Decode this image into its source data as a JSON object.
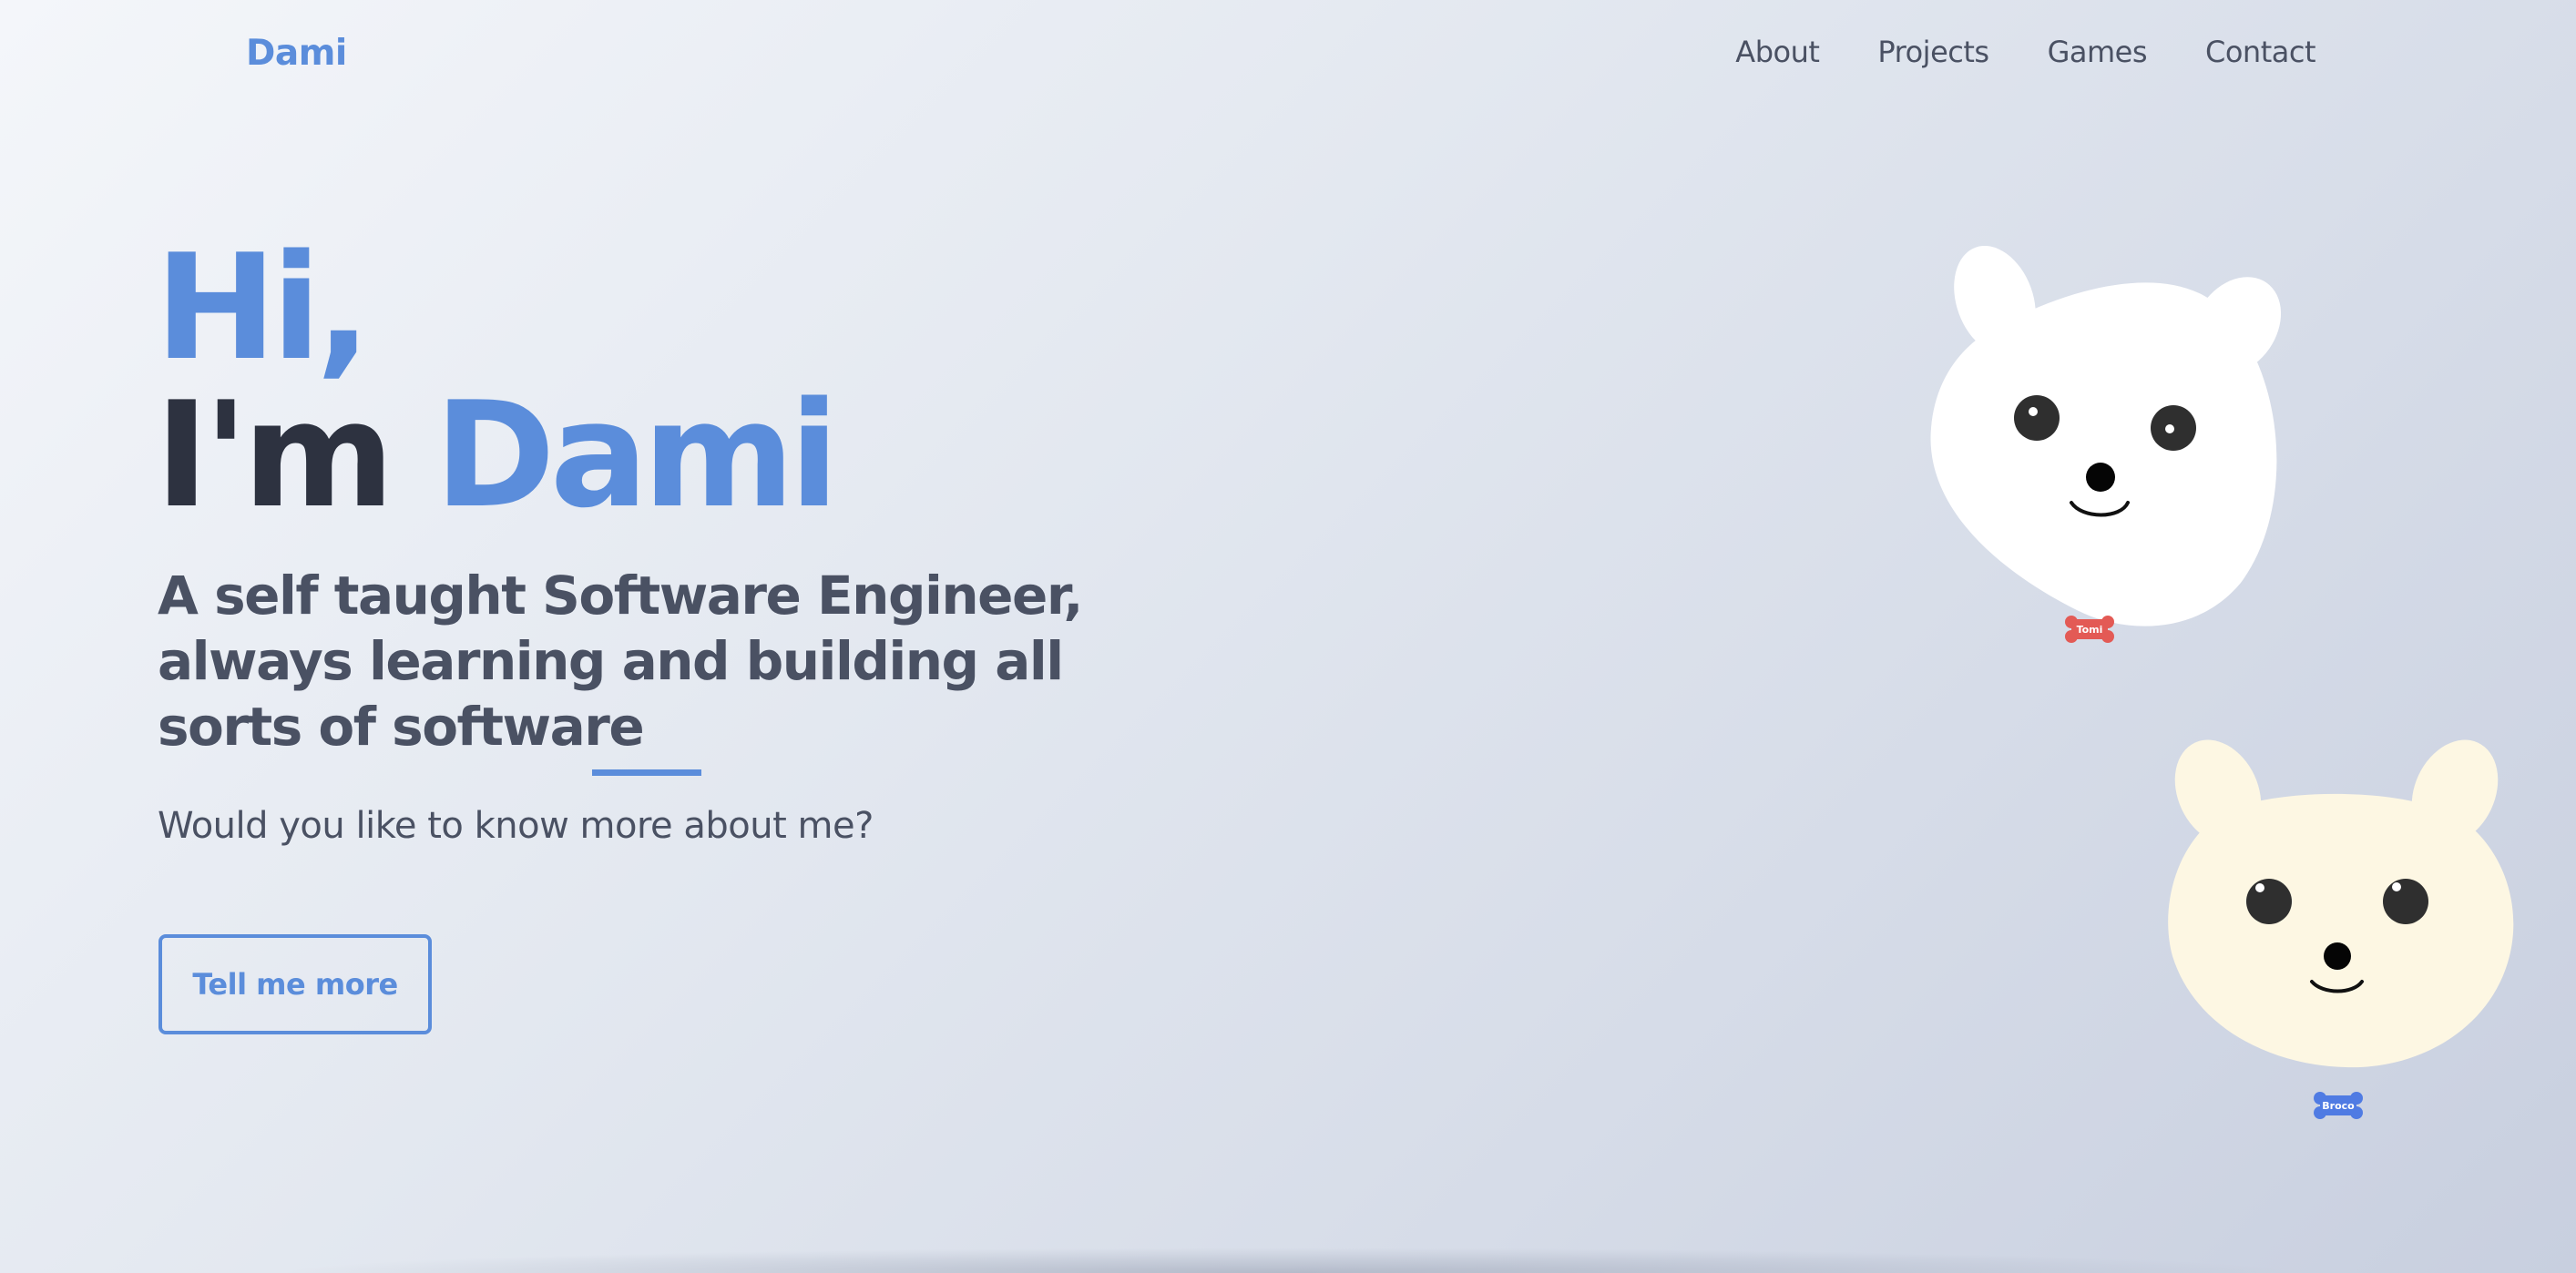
{
  "nav": {
    "brand": "Dami",
    "links": [
      "About",
      "Projects",
      "Games",
      "Contact"
    ]
  },
  "hero": {
    "greeting": "Hi,",
    "intro_prefix": "I'm",
    "intro_name": "Dami",
    "subtitle": "A self taught Software Engineer, always learning and building all sorts of software",
    "question": "Would you like to know more about me?",
    "cta_label": "Tell me more"
  },
  "pets": [
    {
      "name": "Tomi",
      "fur_color": "#ffffff",
      "tag_color": "#e35a55"
    },
    {
      "name": "Broco",
      "fur_color": "#fdf7e3",
      "tag_color": "#4f7be3"
    }
  ],
  "colors": {
    "accent": "#5b8ddb",
    "heading_dark": "#2d3240",
    "text_muted": "#4a5163"
  }
}
